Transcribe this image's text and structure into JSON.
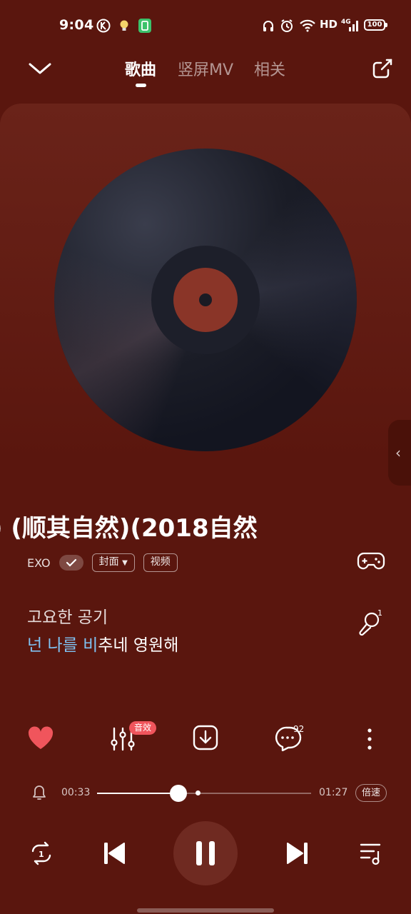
{
  "status_bar": {
    "time": "9:04",
    "network_label": "HD",
    "cellular_label": "4G",
    "battery": "100",
    "icons": [
      "k-app-icon",
      "bulb-icon",
      "battery-app-icon",
      "headphones-icon",
      "alarm-icon",
      "wifi-icon",
      "signal-icon"
    ]
  },
  "header": {
    "tabs": [
      {
        "label": "歌曲",
        "active": true
      },
      {
        "label": "竖屏MV",
        "active": false
      },
      {
        "label": "相关",
        "active": false
      }
    ],
    "icons": [
      "chevron-down-icon",
      "share-icon"
    ]
  },
  "song": {
    "title": ") (顺其自然)(2018自然",
    "artist": "EXO",
    "cover_label": "封面",
    "video_label": "视频"
  },
  "lyrics": {
    "line1": "고요한 공기",
    "line2_sung": "넌 나를 비",
    "line2_rest": "추네 영원해"
  },
  "actions": {
    "effects_badge": "音效",
    "comment_count": "92",
    "icons": [
      "heart-icon",
      "equalizer-icon",
      "download-icon",
      "comment-icon",
      "more-icon"
    ]
  },
  "progress": {
    "elapsed": "00:33",
    "total": "01:27",
    "fraction": 0.38,
    "speed_label": "倍速"
  },
  "controls": {
    "icons": [
      "repeat-one-icon",
      "previous-icon",
      "pause-icon",
      "next-icon",
      "playlist-icon"
    ]
  },
  "colors": {
    "background": "#5a160e",
    "lyric_highlight": "#7fc2f2",
    "heart": "#f0555c"
  }
}
